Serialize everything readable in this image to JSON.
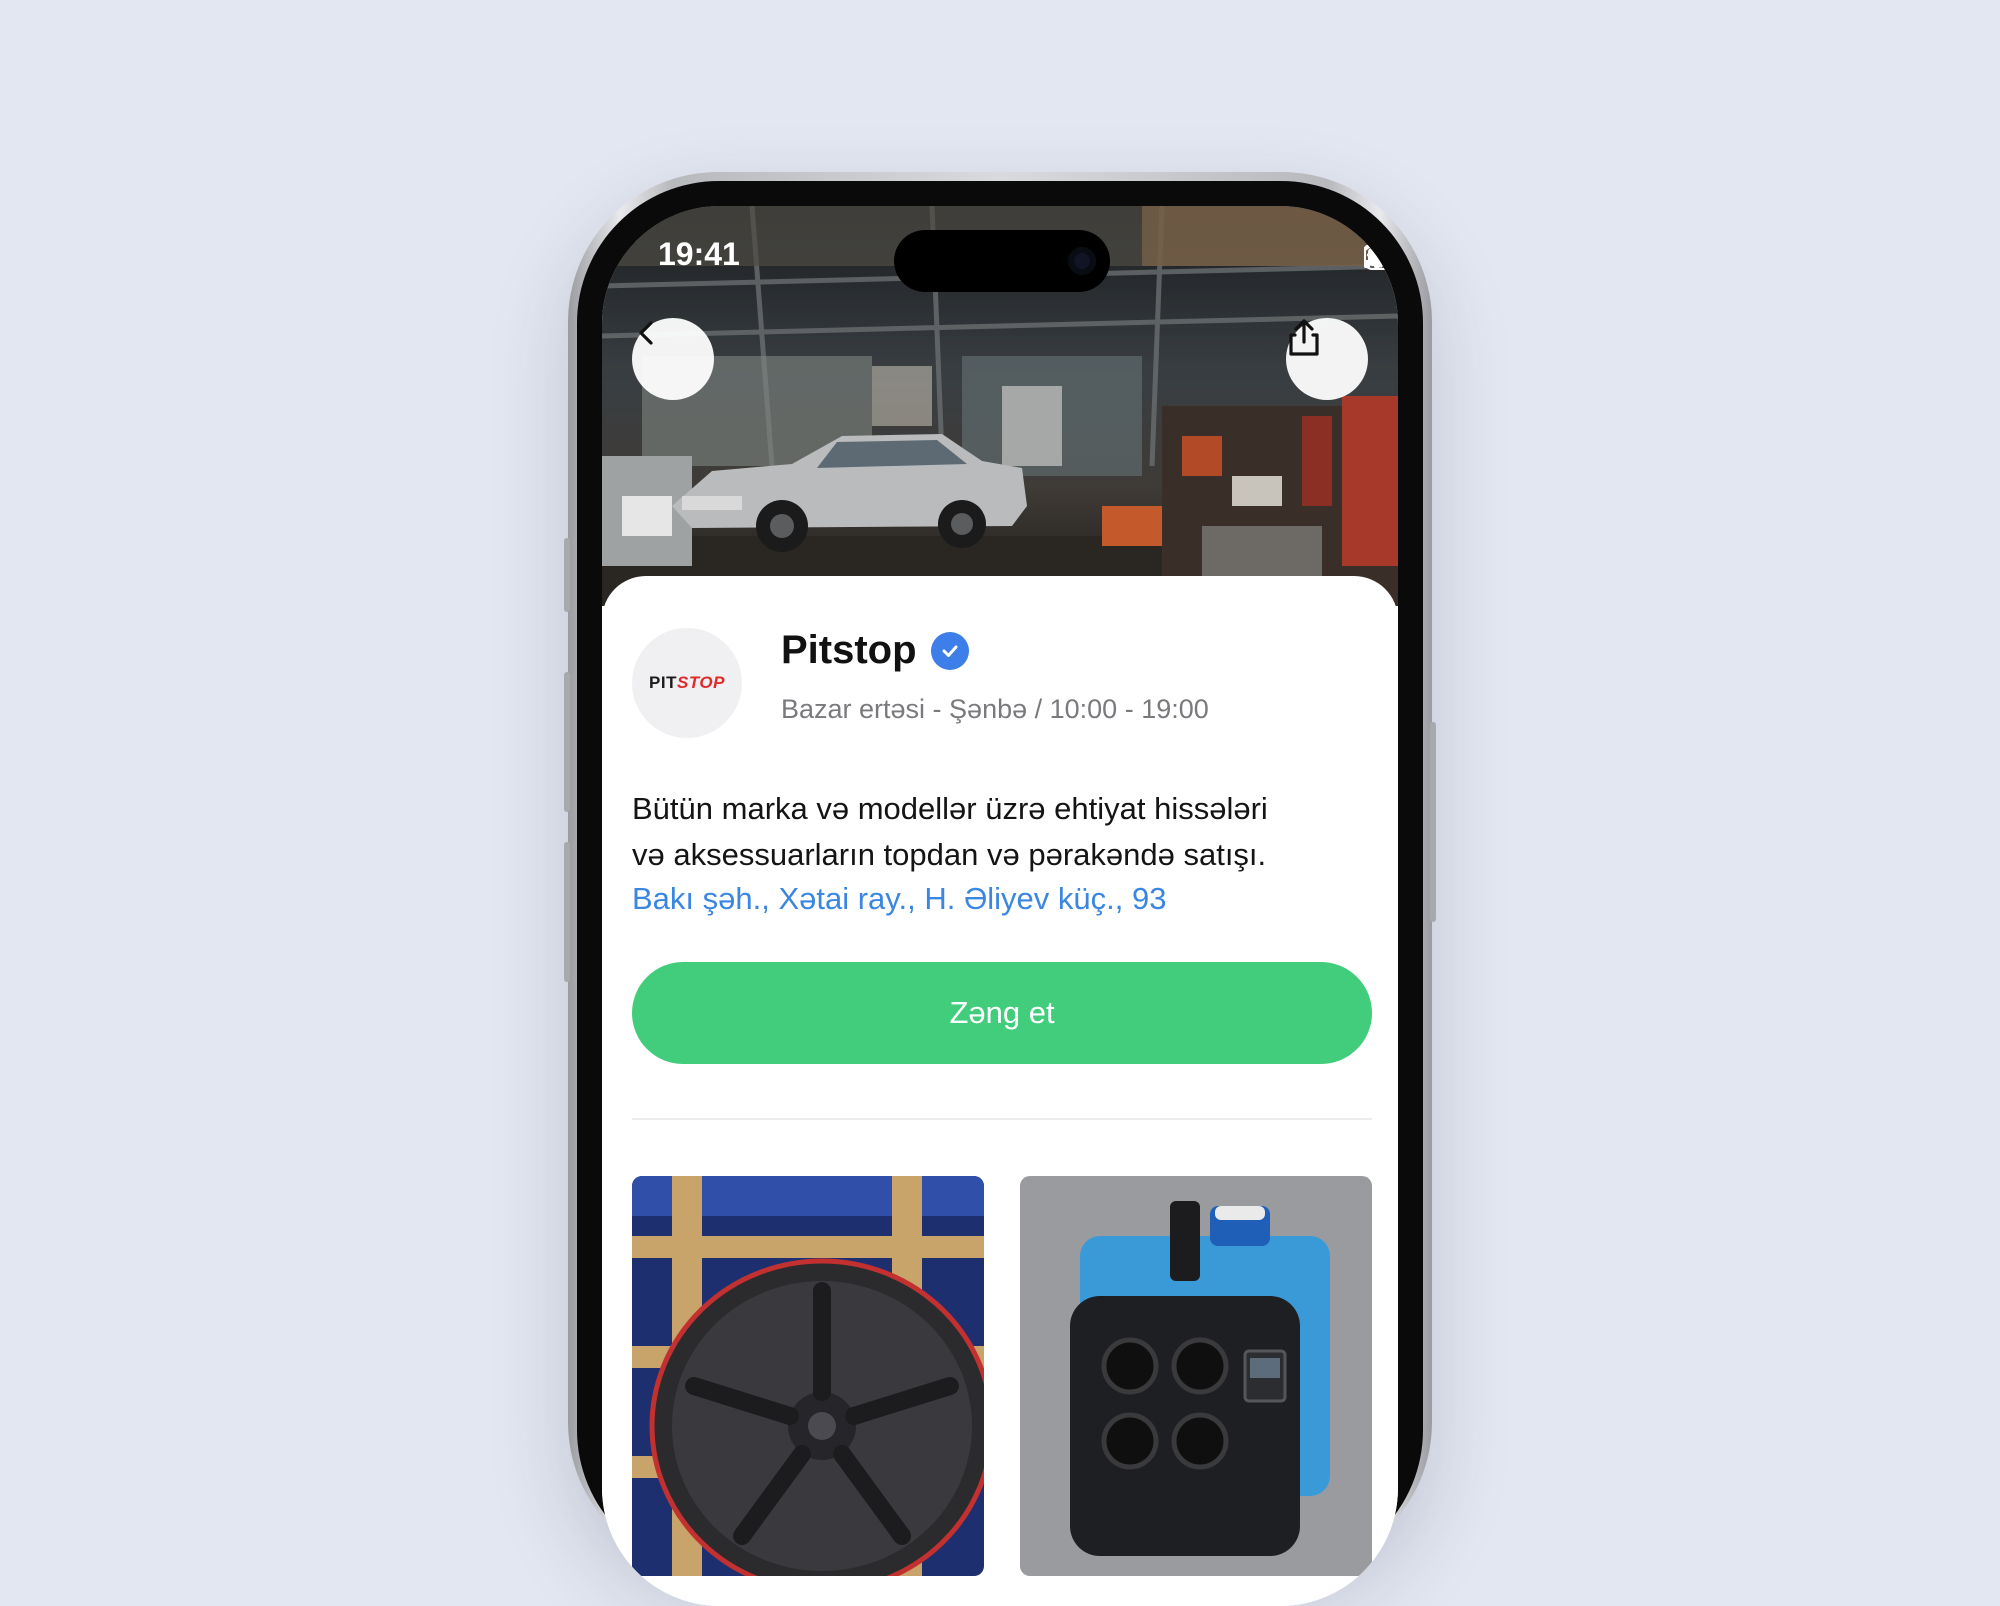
{
  "status_bar": {
    "time": "19:41"
  },
  "hero": {
    "back_icon": "chevron-left-icon",
    "share_icon": "share-icon"
  },
  "shop": {
    "logo_part1": "PIT",
    "logo_part2": "STOP",
    "name": "Pitstop",
    "verified_icon": "verified-badge-icon",
    "hours": "Bazar ertəsi - Şənbə / 10:00 - 19:00",
    "description_line1": "Bütün marka və modellər üzrə ehtiyat hissələri",
    "description_line2": "və aksessuarların topdan və pərakəndə satışı.",
    "address": "Bakı şəh., Xətai ray., H. Əliyev küç., 93",
    "call_label": "Zəng et"
  },
  "colors": {
    "accent_green": "#42cd7c",
    "link_blue": "#3a86e0",
    "verified_blue": "#3d7ee8",
    "background": "#e3e7f1",
    "logo_red": "#e02a2a"
  }
}
